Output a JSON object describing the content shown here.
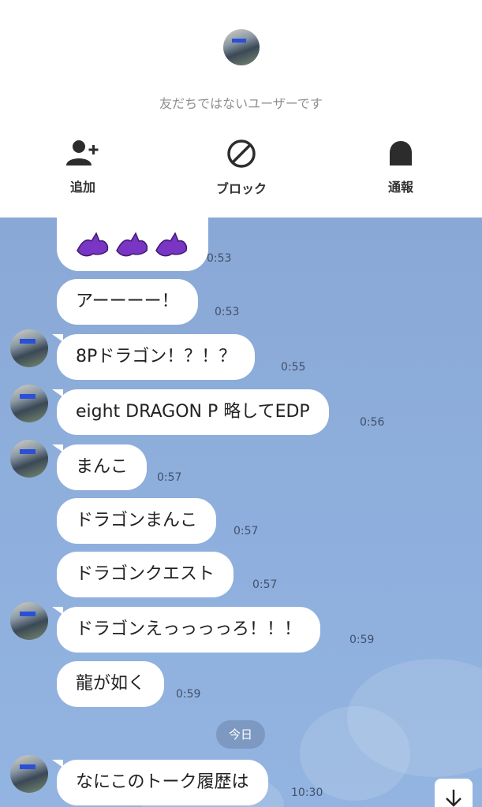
{
  "header": {
    "notice": "友だちではないユーザーです",
    "actions": {
      "add": "追加",
      "block": "ブロック",
      "report": "通報"
    }
  },
  "messages": [
    {
      "text": "🐉🐉🐉",
      "time": "0:53"
    },
    {
      "text": "アーーーー！",
      "time": "0:53"
    },
    {
      "text": "8Pドラゴン！？！？",
      "time": "0:55"
    },
    {
      "text": "eight DRAGON P 略してEDP",
      "time": "0:56"
    },
    {
      "text": "まんこ",
      "time": "0:57"
    },
    {
      "text": "ドラゴンまんこ",
      "time": "0:57"
    },
    {
      "text": "ドラゴンクエスト",
      "time": "0:57"
    },
    {
      "text": "ドラゴンえっっっっろ！！！",
      "time": "0:59"
    },
    {
      "text": "龍が如く",
      "time": "0:59"
    },
    {
      "text": "なにこのトーク履歴は",
      "time": "10:30"
    }
  ],
  "date_separator": "今日",
  "colors": {
    "chat_bg": "#8fb0de",
    "bubble": "#ffffff",
    "dragon": "#7a35c4"
  },
  "icons": {
    "add_friend": "person-plus-icon",
    "block": "block-icon",
    "report": "report-bell-icon",
    "scroll_down": "arrow-down-icon"
  }
}
